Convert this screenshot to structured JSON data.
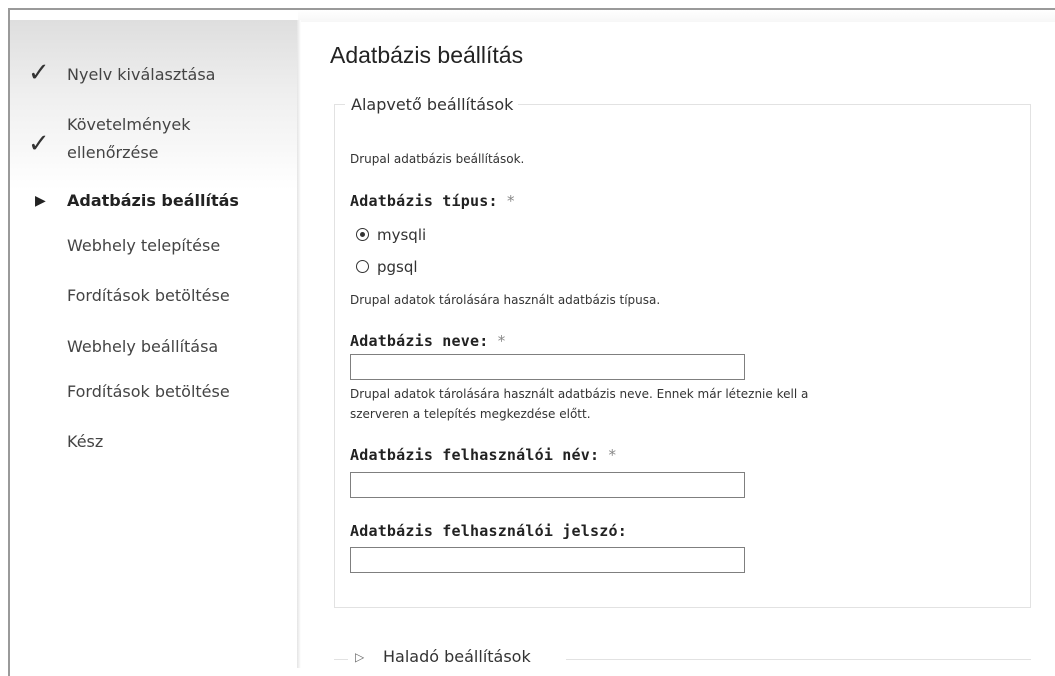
{
  "sidebar": {
    "tasks": [
      {
        "label": "Nyelv kiválasztása",
        "status": "done"
      },
      {
        "label": "Követelmények ellenőrzése",
        "line1": "Követelmények",
        "line2": "ellenőrzése",
        "status": "done"
      },
      {
        "label": "Adatbázis beállítás",
        "status": "active"
      },
      {
        "label": "Webhely telepítése",
        "status": "pending"
      },
      {
        "label": "Fordítások betöltése",
        "status": "pending"
      },
      {
        "label": "Webhely beállítása",
        "status": "pending"
      },
      {
        "label": "Fordítások betöltése",
        "status": "pending"
      },
      {
        "label": "Kész",
        "status": "pending"
      }
    ]
  },
  "main": {
    "title": "Adatbázis beállítás",
    "basic": {
      "legend": "Alapvető beállítások",
      "description": "Drupal adatbázis beállítások.",
      "db_type": {
        "label": "Adatbázis típus:",
        "required": "*",
        "options": [
          "mysqli",
          "pgsql"
        ],
        "selected": "mysqli",
        "description": "Drupal adatok tárolására használt adatbázis típusa."
      },
      "db_name": {
        "label": "Adatbázis neve:",
        "required": "*",
        "value": "",
        "description_line1": "Drupal adatok tárolására használt adatbázis neve. Ennek már léteznie kell a",
        "description_line2": "szerveren a telepítés megkezdése előtt."
      },
      "db_user": {
        "label": "Adatbázis felhasználói név:",
        "required": "*",
        "value": ""
      },
      "db_pass": {
        "label": "Adatbázis felhasználói jelszó:",
        "value": ""
      }
    },
    "advanced": {
      "legend": "Haladó beállítások"
    }
  }
}
